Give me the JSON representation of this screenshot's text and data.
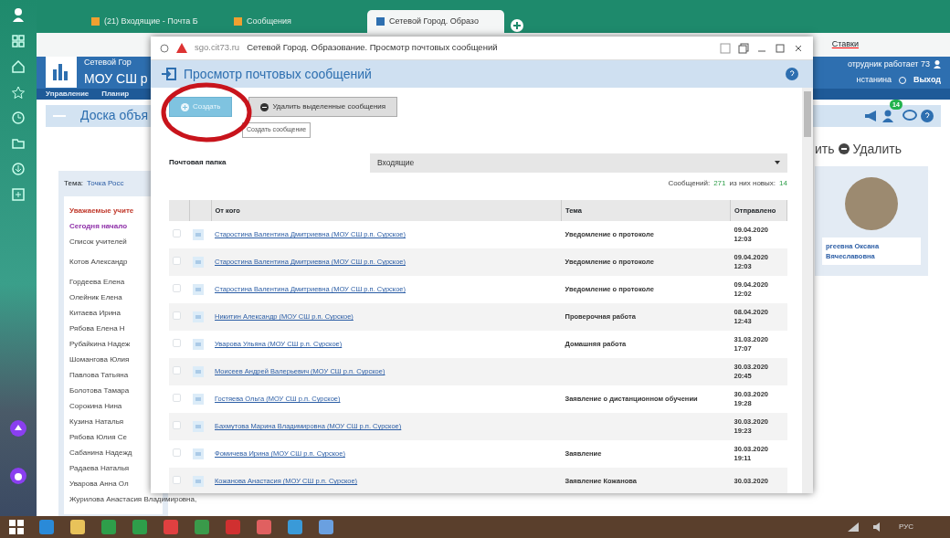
{
  "browser": {
    "tabs": [
      {
        "label": "(21) Входящие - Почта Б",
        "selected": false
      },
      {
        "label": "Сообщения",
        "selected": false
      },
      {
        "label": "Сетевой Город. Образо",
        "selected": true
      }
    ],
    "address_hint": "Ставки"
  },
  "site": {
    "brand": "Сетевой Гор",
    "school": "МОУ СШ р",
    "nav": [
      "Управление",
      "Планир"
    ],
    "user": "отрудник работает 73",
    "user_name": "нстанина",
    "logout": "Выход",
    "notification_count": "14",
    "board_title": "Доска объя",
    "edit_action": "ить",
    "delete_action": "Удалить",
    "topic_label": "Тема:",
    "topic": "Точка Росс",
    "post_lines": [
      {
        "text": "Уважаемые учите",
        "kind": "alert"
      },
      {
        "text": "Сегодня начало",
        "kind": "notice"
      },
      {
        "text": "Список учителей",
        "kind": "plain"
      },
      {
        "text": "Котов Александр",
        "kind": "plain"
      },
      {
        "text": "Гордеева Елена",
        "kind": "plain"
      },
      {
        "text": "Олейник Елена",
        "kind": "plain"
      },
      {
        "text": "Китаева Ирина",
        "kind": "plain"
      },
      {
        "text": "Рябова Елена Н",
        "kind": "plain"
      },
      {
        "text": "Рубайкина Надеж",
        "kind": "plain"
      },
      {
        "text": "Шомангова Юлия",
        "kind": "plain"
      },
      {
        "text": "Павлова Татьяна",
        "kind": "plain"
      },
      {
        "text": "Болотова Тамара",
        "kind": "plain"
      },
      {
        "text": "Сорокина Нина",
        "kind": "plain"
      },
      {
        "text": "Кузина Наталья",
        "kind": "plain"
      },
      {
        "text": "Рябова Юлия Се",
        "kind": "plain"
      },
      {
        "text": "Сабанина Надежд",
        "kind": "plain"
      },
      {
        "text": "Радаева Наталья",
        "kind": "plain"
      },
      {
        "text": "Уварова Анна Ол",
        "kind": "plain"
      },
      {
        "text": "Журилова Анастасия Владимировна,",
        "kind": "plain"
      }
    ],
    "author": [
      "ргеевна Оксана",
      "Вячеславовна"
    ]
  },
  "popup": {
    "domain": "sgo.cit73.ru",
    "title": "Сетевой Город. Образование. Просмотр почтовых сообщений",
    "heading": "Просмотр почтовых сообщений",
    "buttons": [
      {
        "label": "Создать",
        "kind": "primary"
      },
      {
        "label": "Удалить выделенные сообщения",
        "kind": "secondary"
      }
    ],
    "tooltip": "Создать сообщение",
    "folder_label": "Почтовая папка",
    "folder": "Входящие",
    "count_label": "Сообщений:",
    "count": "271",
    "new_label": "из них новых:",
    "new_count": "14",
    "columns": [
      "От кого",
      "Тема",
      "Отправлено"
    ],
    "rows": [
      {
        "from": "Старостина Валентина Дмитриевна (МОУ СШ р.п. Сурское)",
        "subject": "Уведомление о протоколе",
        "date": "09.04.2020",
        "time": "12:03",
        "checked": false
      },
      {
        "from": "Старостина Валентина Дмитриевна (МОУ СШ р.п. Сурское)",
        "subject": "Уведомление о протоколе",
        "date": "09.04.2020",
        "time": "12:03",
        "checked": false
      },
      {
        "from": "Старостина Валентина Дмитриевна (МОУ СШ р.п. Сурское)",
        "subject": "Уведомление о протоколе",
        "date": "09.04.2020",
        "time": "12:02",
        "checked": false
      },
      {
        "from": "Никитин Александр (МОУ СШ р.п. Сурское)",
        "subject": "Проверочная работа",
        "date": "08.04.2020",
        "time": "12:43",
        "checked": false
      },
      {
        "from": "Уварова Ульяна (МОУ СШ р.п. Сурское)",
        "subject": "Домашняя работа",
        "date": "31.03.2020",
        "time": "17:07",
        "checked": false
      },
      {
        "from": "Моисеев Андрей Валерьевич (МОУ СШ р.п. Сурское)",
        "subject": "",
        "date": "30.03.2020",
        "time": "20:45",
        "checked": false
      },
      {
        "from": "Гостяева Ольга (МОУ СШ р.п. Сурское)",
        "subject": "Заявление о дистанционном обучении",
        "date": "30.03.2020",
        "time": "19:28",
        "checked": false
      },
      {
        "from": "Бахмутова Марина Владимировна (МОУ СШ р.п. Сурское)",
        "subject": "",
        "date": "30.03.2020",
        "time": "19:23",
        "checked": false
      },
      {
        "from": "Фомичева Ирина (МОУ СШ р.п. Сурское)",
        "subject": "Заявление",
        "date": "30.03.2020",
        "time": "19:11",
        "checked": false
      },
      {
        "from": "Кожанова Анастасия (МОУ СШ р.п. Сурское)",
        "subject": "Заявление Кожанова",
        "date": "30.03.2020",
        "time": "",
        "checked": false
      }
    ]
  },
  "taskbar": {
    "language": "РУС"
  }
}
